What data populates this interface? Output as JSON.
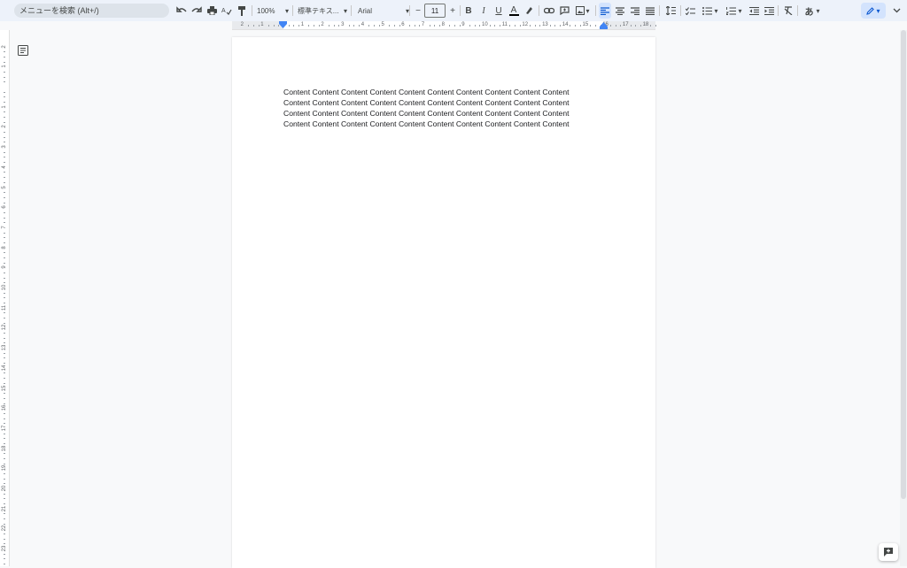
{
  "toolbar": {
    "search_placeholder": "メニューを検索 (Alt+/)",
    "zoom": "100%",
    "style": "標準テキス...",
    "font": "Arial",
    "font_size": "11",
    "decrease_label": "−",
    "increase_label": "+",
    "bold_label": "B",
    "italic_label": "I",
    "underline_label": "U",
    "text_color_label": "A",
    "input_tools_label": "あ",
    "dropdown_glyph": "▾"
  },
  "ruler": {
    "horizontal_ticks": [
      "2",
      "1",
      "1",
      "2",
      "3",
      "4",
      "5",
      "6",
      "7",
      "8",
      "9",
      "10",
      "11",
      "12",
      "13",
      "14",
      "15",
      "16",
      "17",
      "18"
    ],
    "vertical_ticks": [
      "2",
      "1",
      "1",
      "2",
      "3",
      "4",
      "5",
      "6",
      "7",
      "8",
      "9",
      "10",
      "11",
      "12",
      "13",
      "14",
      "15",
      "16",
      "17",
      "18",
      "19",
      "20",
      "21",
      "22",
      "23"
    ]
  },
  "document": {
    "lines": [
      "Content Content Content Content Content Content Content Content Content Content",
      "Content Content Content Content Content Content Content Content Content Content",
      "Content Content Content Content Content Content Content Content Content Content",
      "Content Content Content Content Content Content Content Content Content Content"
    ]
  },
  "colors": {
    "accent": "#0b57d0",
    "toolbar_bg": "#edf2fa",
    "active_bg": "#d3e3fd"
  }
}
